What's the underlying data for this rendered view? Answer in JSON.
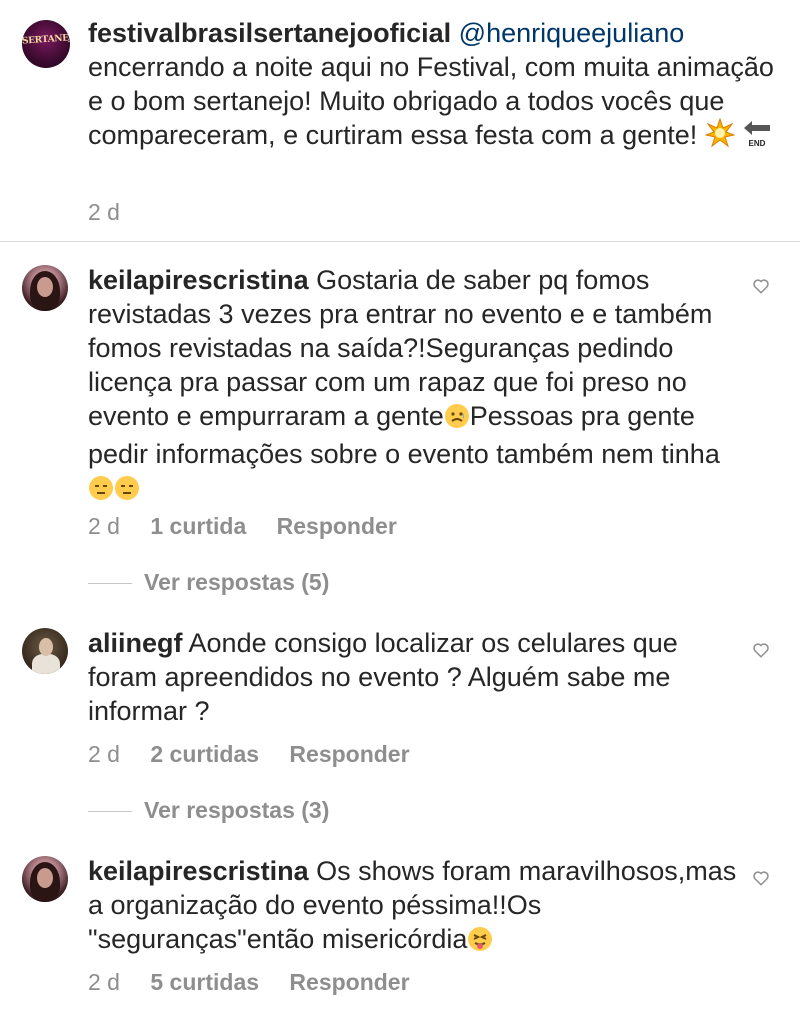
{
  "caption": {
    "username": "festivalbrasilsertanejooficial",
    "mention": "@henriqueejuliano",
    "text": "encerrando a noite aqui no Festival, com muita animação e o bom sertanejo! Muito obrigado a todos vocês que compareceram, e curtiram essa festa com a gente!",
    "avatar_logo": "SERTANEJO",
    "time": "2 d",
    "emojis": [
      "sparkle-burst-icon",
      "end-arrow-icon"
    ]
  },
  "comments": [
    {
      "username": "keilapirescristina",
      "text_part1": "Gostaria de saber pq fomos revistadas 3 vezes pra entrar no evento e e também fomos revistadas na saída?!Seguranças pedindo licença pra passar com um rapaz que foi preso no evento e empurraram a gente",
      "text_part2": "Pessoas pra gente pedir informações sobre o evento também nem tinha",
      "time": "2 d",
      "likes": "1 curtida",
      "reply": "Responder",
      "view_replies": "Ver respostas (5)"
    },
    {
      "username": "aliinegf",
      "text_part1": "Aonde consigo localizar os celulares que foram apreendidos no evento ? Alguém sabe me informar ?",
      "time": "2 d",
      "likes": "2 curtidas",
      "reply": "Responder",
      "view_replies": "Ver respostas (3)"
    },
    {
      "username": "keilapirescristina",
      "text_part1": "Os shows foram maravilhosos,mas a organização do evento péssima!!Os \"seguranças\"então misericórdia",
      "time": "2 d",
      "likes": "5 curtidas",
      "reply": "Responder"
    }
  ],
  "colors": {
    "text": "#262626",
    "meta": "#8e8e8e",
    "mention": "#00376b",
    "divider": "#dbdbdb"
  }
}
